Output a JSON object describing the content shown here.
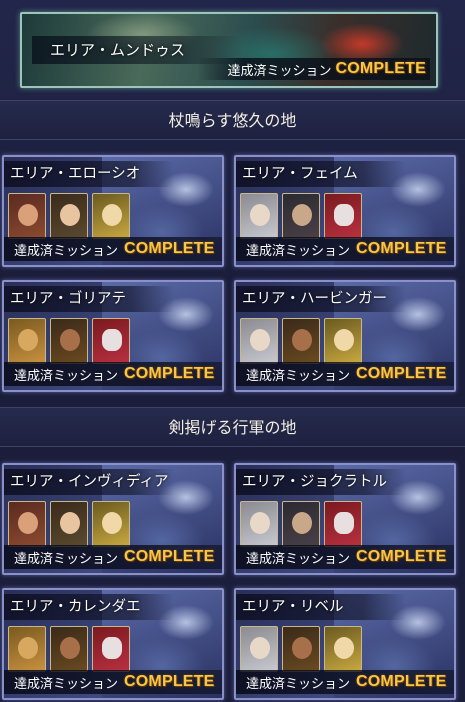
{
  "top_area": {
    "name": "エリア・ムンドゥス",
    "mission_label": "達成済ミッション",
    "status": "COMPLETE"
  },
  "sections": [
    {
      "title": "杖鳴らす悠久の地",
      "areas": [
        {
          "name": "エリア・エローシオ",
          "mission_label": "達成済ミッション",
          "status": "COMPLETE"
        },
        {
          "name": "エリア・フェイム",
          "mission_label": "達成済ミッション",
          "status": "COMPLETE"
        },
        {
          "name": "エリア・ゴリアテ",
          "mission_label": "達成済ミッション",
          "status": "COMPLETE"
        },
        {
          "name": "エリア・ハービンガー",
          "mission_label": "達成済ミッション",
          "status": "COMPLETE"
        }
      ]
    },
    {
      "title": "剣掲げる行軍の地",
      "areas": [
        {
          "name": "エリア・インヴィディア",
          "mission_label": "達成済ミッション",
          "status": "COMPLETE"
        },
        {
          "name": "エリア・ジョクラトル",
          "mission_label": "達成済ミッション",
          "status": "COMPLETE"
        },
        {
          "name": "エリア・カレンダエ",
          "mission_label": "達成済ミッション",
          "status": "COMPLETE"
        },
        {
          "name": "エリア・リベル",
          "mission_label": "達成済ミッション",
          "status": "COMPLETE"
        }
      ]
    }
  ],
  "colors": {
    "complete": "#f7c64a",
    "card_border": "#8a90c8",
    "banner_border": "#9ec6b8"
  }
}
